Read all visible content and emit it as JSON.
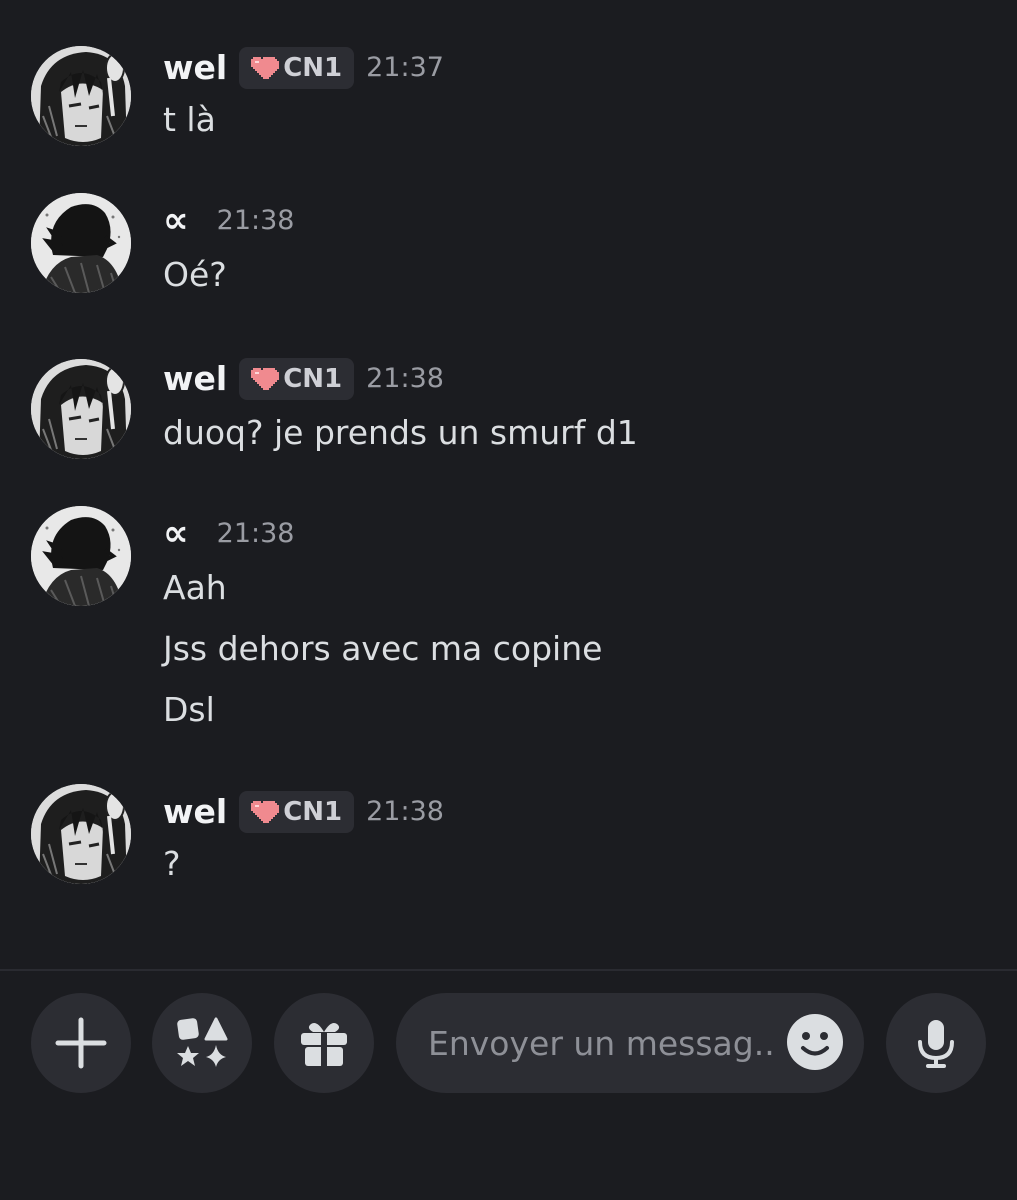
{
  "messages": [
    {
      "author": "wel",
      "tag": "CN1",
      "time": "21:37",
      "lines": [
        "t là"
      ]
    },
    {
      "author": "∝",
      "time": "21:38",
      "lines": [
        "Oé?"
      ]
    },
    {
      "author": "wel",
      "tag": "CN1",
      "time": "21:38",
      "lines": [
        "duoq? je prends un smurf d1"
      ]
    },
    {
      "author": "∝",
      "time": "21:38",
      "lines": [
        "Aah",
        "Jss dehors avec ma copine",
        "Dsl"
      ]
    },
    {
      "author": "wel",
      "tag": "CN1",
      "time": "21:38",
      "lines": [
        "?"
      ]
    }
  ],
  "composer": {
    "placeholder": "Envoyer un messag.."
  },
  "icons": {
    "attach": "plus-icon",
    "apps": "apps-shapes-icon",
    "gift": "gift-icon",
    "emoji": "smiley-icon",
    "voice": "microphone-icon",
    "tag_badge": "pixel-heart-icon"
  },
  "colors": {
    "background": "#1b1c20",
    "surface": "#2c2d33",
    "text": "#dbdee1",
    "muted": "#9a9ca3",
    "heart": "#f08a8f"
  }
}
